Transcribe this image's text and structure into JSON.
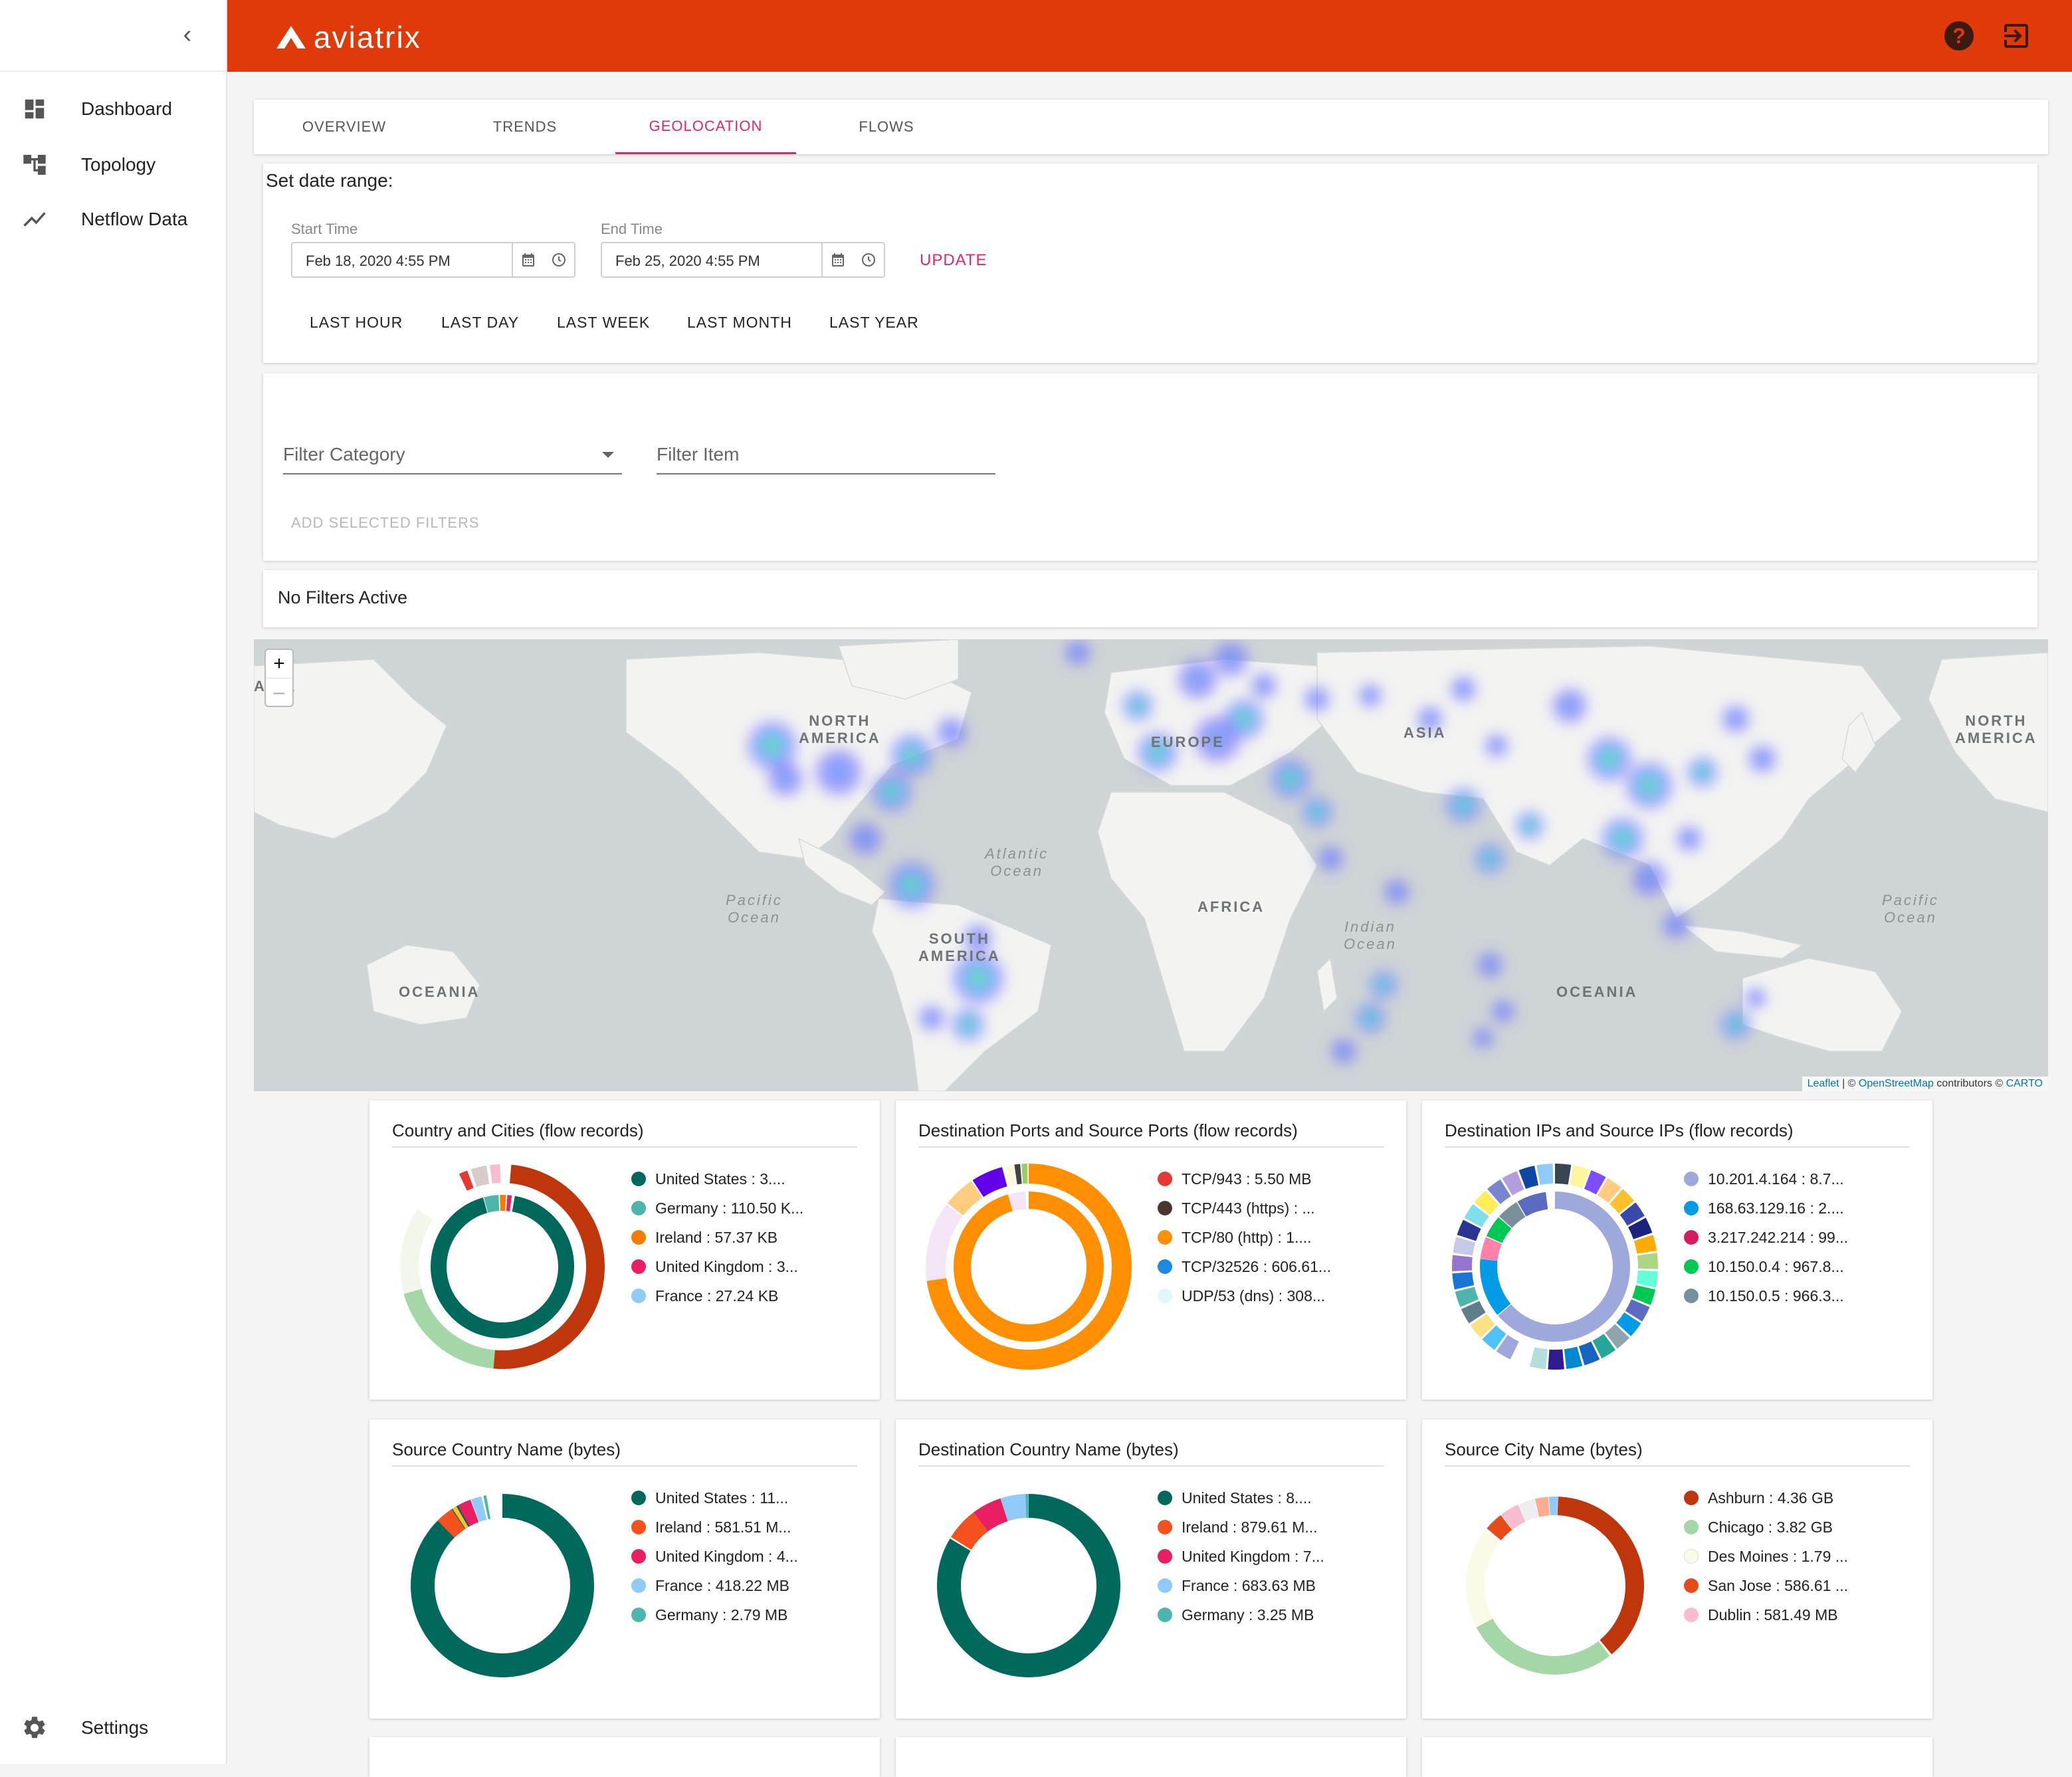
{
  "sidebar": {
    "collapse_icon": "chevron-left-icon",
    "items": [
      {
        "label": "Dashboard",
        "icon": "dashboard-icon"
      },
      {
        "label": "Topology",
        "icon": "topology-icon"
      },
      {
        "label": "Netflow Data",
        "icon": "trending-icon"
      }
    ],
    "settings_label": "Settings"
  },
  "header": {
    "brand": "aviatrix",
    "color": "#e03a0a",
    "help_icon": "help-icon",
    "logout_icon": "logout-icon"
  },
  "tabs": [
    {
      "label": "OVERVIEW",
      "active": false
    },
    {
      "label": "TRENDS",
      "active": false
    },
    {
      "label": "GEOLOCATION",
      "active": true
    },
    {
      "label": "FLOWS",
      "active": false
    }
  ],
  "date_range": {
    "title": "Set date range:",
    "start_label": "Start Time",
    "start_value": "Feb 18, 2020 4:55 PM",
    "end_label": "End Time",
    "end_value": "Feb 25, 2020 4:55 PM",
    "update_label": "UPDATE",
    "quick_ranges": [
      "LAST HOUR",
      "LAST DAY",
      "LAST WEEK",
      "LAST MONTH",
      "LAST YEAR"
    ]
  },
  "filters": {
    "category_placeholder": "Filter Category",
    "item_placeholder": "Filter Item",
    "add_label": "ADD SELECTED FILTERS",
    "active_text": "No Filters Active"
  },
  "map": {
    "labels": {
      "asia_left": "ASIA",
      "north_america": "NORTH\nAMERICA",
      "europe": "EUROPE",
      "asia": "ASIA",
      "north_america_right": "NORTH\nAMERICA",
      "atlantic": "Atlantic\nOcean",
      "pacific_left": "Pacific\nOcean",
      "pacific_right": "Pacific\nOcean",
      "africa": "AFRICA",
      "south_america": "SOUTH\nAMERICA",
      "indian": "Indian\nOcean",
      "oceania_left": "OCEANIA",
      "oceania_right": "OCEANIA"
    },
    "zoom_in": "+",
    "zoom_out": "–",
    "attribution": {
      "leaflet": "Leaflet",
      "sep": " | © ",
      "osm": "OpenStreetMap",
      "contrib": " contributors © ",
      "carto": "CARTO"
    }
  },
  "cards": [
    {
      "title": "Country and Cities (flow records)",
      "legend": [
        {
          "label": "United States : 3....",
          "color": "#00695c"
        },
        {
          "label": "Germany : 110.50 K...",
          "color": "#4db6ac"
        },
        {
          "label": "Ireland : 57.37 KB",
          "color": "#f57c00"
        },
        {
          "label": "United Kingdom : 3...",
          "color": "#e91e63"
        },
        {
          "label": "France : 27.24 KB",
          "color": "#90caf9"
        }
      ]
    },
    {
      "title": "Destination Ports and Source Ports (flow records)",
      "legend": [
        {
          "label": "TCP/943 : 5.50 MB",
          "color": "#e53935"
        },
        {
          "label": "TCP/443 (https) : ...",
          "color": "#4e342e"
        },
        {
          "label": "TCP/80 (http) : 1....",
          "color": "#ff8f00"
        },
        {
          "label": "TCP/32526 : 606.61...",
          "color": "#1e88e5"
        },
        {
          "label": "UDP/53 (dns) : 308...",
          "color": "#e0f7fa"
        }
      ]
    },
    {
      "title": "Destination IPs and Source IPs (flow records)",
      "legend": [
        {
          "label": "10.201.4.164 : 8.7...",
          "color": "#9fa8da"
        },
        {
          "label": "168.63.129.16 : 2....",
          "color": "#039be5"
        },
        {
          "label": "3.217.242.214 : 99...",
          "color": "#d81b60"
        },
        {
          "label": "10.150.0.4 : 967.8...",
          "color": "#00c853"
        },
        {
          "label": "10.150.0.5 : 966.3...",
          "color": "#78909c"
        }
      ]
    },
    {
      "title": "Source Country Name (bytes)",
      "legend": [
        {
          "label": "United States : 11...",
          "color": "#00695c"
        },
        {
          "label": "Ireland : 581.51 M...",
          "color": "#f4511e"
        },
        {
          "label": "United Kingdom : 4...",
          "color": "#e91e63"
        },
        {
          "label": "France : 418.22 MB",
          "color": "#90caf9"
        },
        {
          "label": "Germany : 2.79 MB",
          "color": "#4db6ac"
        }
      ]
    },
    {
      "title": "Destination Country Name (bytes)",
      "legend": [
        {
          "label": "United States : 8....",
          "color": "#00695c"
        },
        {
          "label": "Ireland : 879.61 M...",
          "color": "#f4511e"
        },
        {
          "label": "United Kingdom : 7...",
          "color": "#e91e63"
        },
        {
          "label": "France : 683.63 MB",
          "color": "#90caf9"
        },
        {
          "label": "Germany : 3.25 MB",
          "color": "#4db6ac"
        }
      ]
    },
    {
      "title": "Source City Name (bytes)",
      "legend": [
        {
          "label": "Ashburn : 4.36 GB",
          "color": "#bf360c"
        },
        {
          "label": "Chicago : 3.82 GB",
          "color": "#a5d6a7"
        },
        {
          "label": "Des Moines : 1.79 ...",
          "color": "#f9fbe7"
        },
        {
          "label": "San Jose : 586.61 ...",
          "color": "#e64a19"
        },
        {
          "label": "Dublin : 581.49 MB",
          "color": "#f8bbd0"
        }
      ]
    }
  ]
}
